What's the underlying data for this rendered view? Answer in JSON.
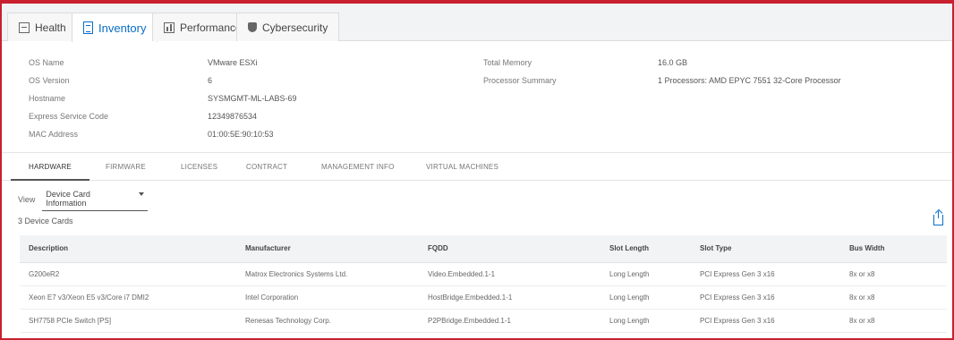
{
  "tabs": [
    {
      "label": "Health",
      "icon": "health-icon"
    },
    {
      "label": "Inventory",
      "icon": "inventory-icon"
    },
    {
      "label": "Performance",
      "icon": "performance-icon"
    },
    {
      "label": "Cybersecurity",
      "icon": "shield-icon"
    }
  ],
  "info_left": [
    {
      "label": "OS Name",
      "value": "VMware ESXi"
    },
    {
      "label": "OS Version",
      "value": "6"
    },
    {
      "label": "Hostname",
      "value": "SYSMGMT-ML-LABS-69"
    },
    {
      "label": "Express Service Code",
      "value": "12349876534"
    },
    {
      "label": "MAC Address",
      "value": "01:00:5E:90:10:53"
    }
  ],
  "info_right": [
    {
      "label": "Total Memory",
      "value": "16.0 GB"
    },
    {
      "label": "Processor Summary",
      "value": "1 Processors: AMD EPYC 7551 32-Core Processor"
    }
  ],
  "subtabs": [
    "HARDWARE",
    "FIRMWARE",
    "LICENSES",
    "CONTRACT",
    "MANAGEMENT INFO",
    "VIRTUAL MACHINES"
  ],
  "view": {
    "label": "View",
    "selected": "Device Card Information"
  },
  "count_label": "3 Device Cards",
  "table": {
    "headers": [
      "Description",
      "Manufacturer",
      "FQDD",
      "Slot Length",
      "Slot Type",
      "Bus Width"
    ],
    "rows": [
      [
        "G200eR2",
        "Matrox Electronics Systems Ltd.",
        "Video.Embedded.1-1",
        "Long Length",
        "PCI Express Gen 3 x16",
        "8x or x8"
      ],
      [
        "Xeon E7 v3/Xeon E5 v3/Core i7 DMI2",
        "Intel Corporation",
        "HostBridge.Embedded.1-1",
        "Long Length",
        "PCI Express Gen 3 x16",
        "8x or x8"
      ],
      [
        "SH7758 PCIe Switch [PS]",
        "Renesas Technology Corp.",
        "P2PBridge.Embedded.1-1",
        "Long Length",
        "PCI Express Gen 3 x16",
        "8x or x8"
      ]
    ]
  },
  "colors": {
    "accent": "#0a6ec6",
    "frame": "#c8202f"
  }
}
